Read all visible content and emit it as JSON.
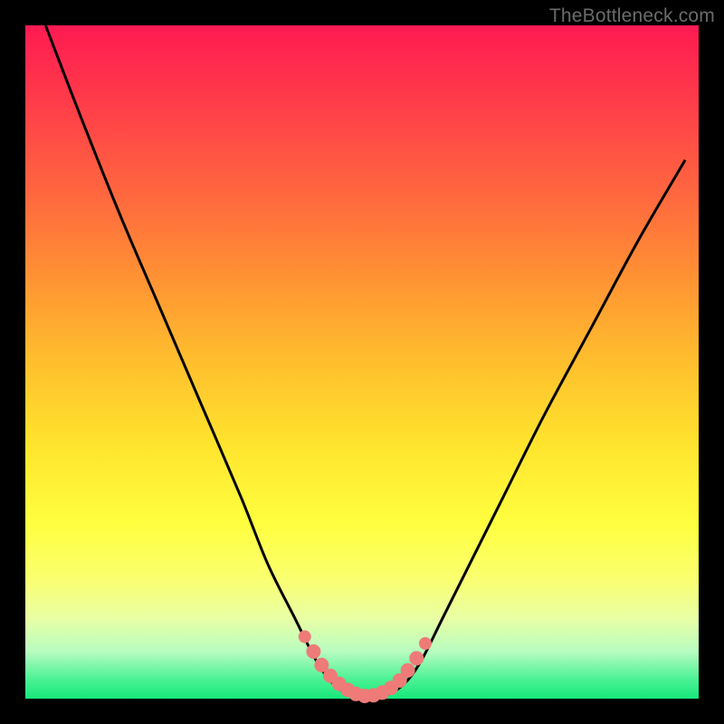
{
  "watermark": "TheBottleneck.com",
  "colors": {
    "frame": "#000000",
    "curve": "#000000",
    "markers": "#ee7b78",
    "gradient_top": "#ff1a52",
    "gradient_bottom": "#16e87a"
  },
  "chart_data": {
    "type": "line",
    "title": "",
    "xlabel": "",
    "ylabel": "",
    "xlim": [
      0,
      100
    ],
    "ylim": [
      0,
      100
    ],
    "grid": false,
    "legend": false,
    "series": [
      {
        "name": "bottleneck-curve",
        "x": [
          3,
          8,
          14,
          20,
          26,
          32,
          36,
          40,
          43,
          45,
          47,
          49,
          51,
          53,
          55,
          57,
          59,
          62,
          66,
          71,
          77,
          84,
          91,
          98
        ],
        "values": [
          100,
          87,
          72,
          58,
          44,
          30,
          20,
          12,
          6,
          3,
          1.2,
          0.4,
          0.2,
          0.4,
          1.2,
          3,
          6,
          12,
          20,
          30,
          42,
          55,
          68,
          80
        ]
      }
    ],
    "markers": {
      "name": "highlight-segment",
      "x": [
        41.5,
        42.8,
        44.0,
        45.3,
        46.6,
        47.9,
        49.1,
        50.4,
        51.7,
        53.0,
        54.3,
        55.6,
        56.8,
        58.1,
        59.4
      ],
      "values": [
        9.2,
        7.0,
        5.0,
        3.4,
        2.2,
        1.3,
        0.7,
        0.4,
        0.5,
        0.9,
        1.6,
        2.7,
        4.2,
        6.0,
        8.2
      ]
    }
  }
}
